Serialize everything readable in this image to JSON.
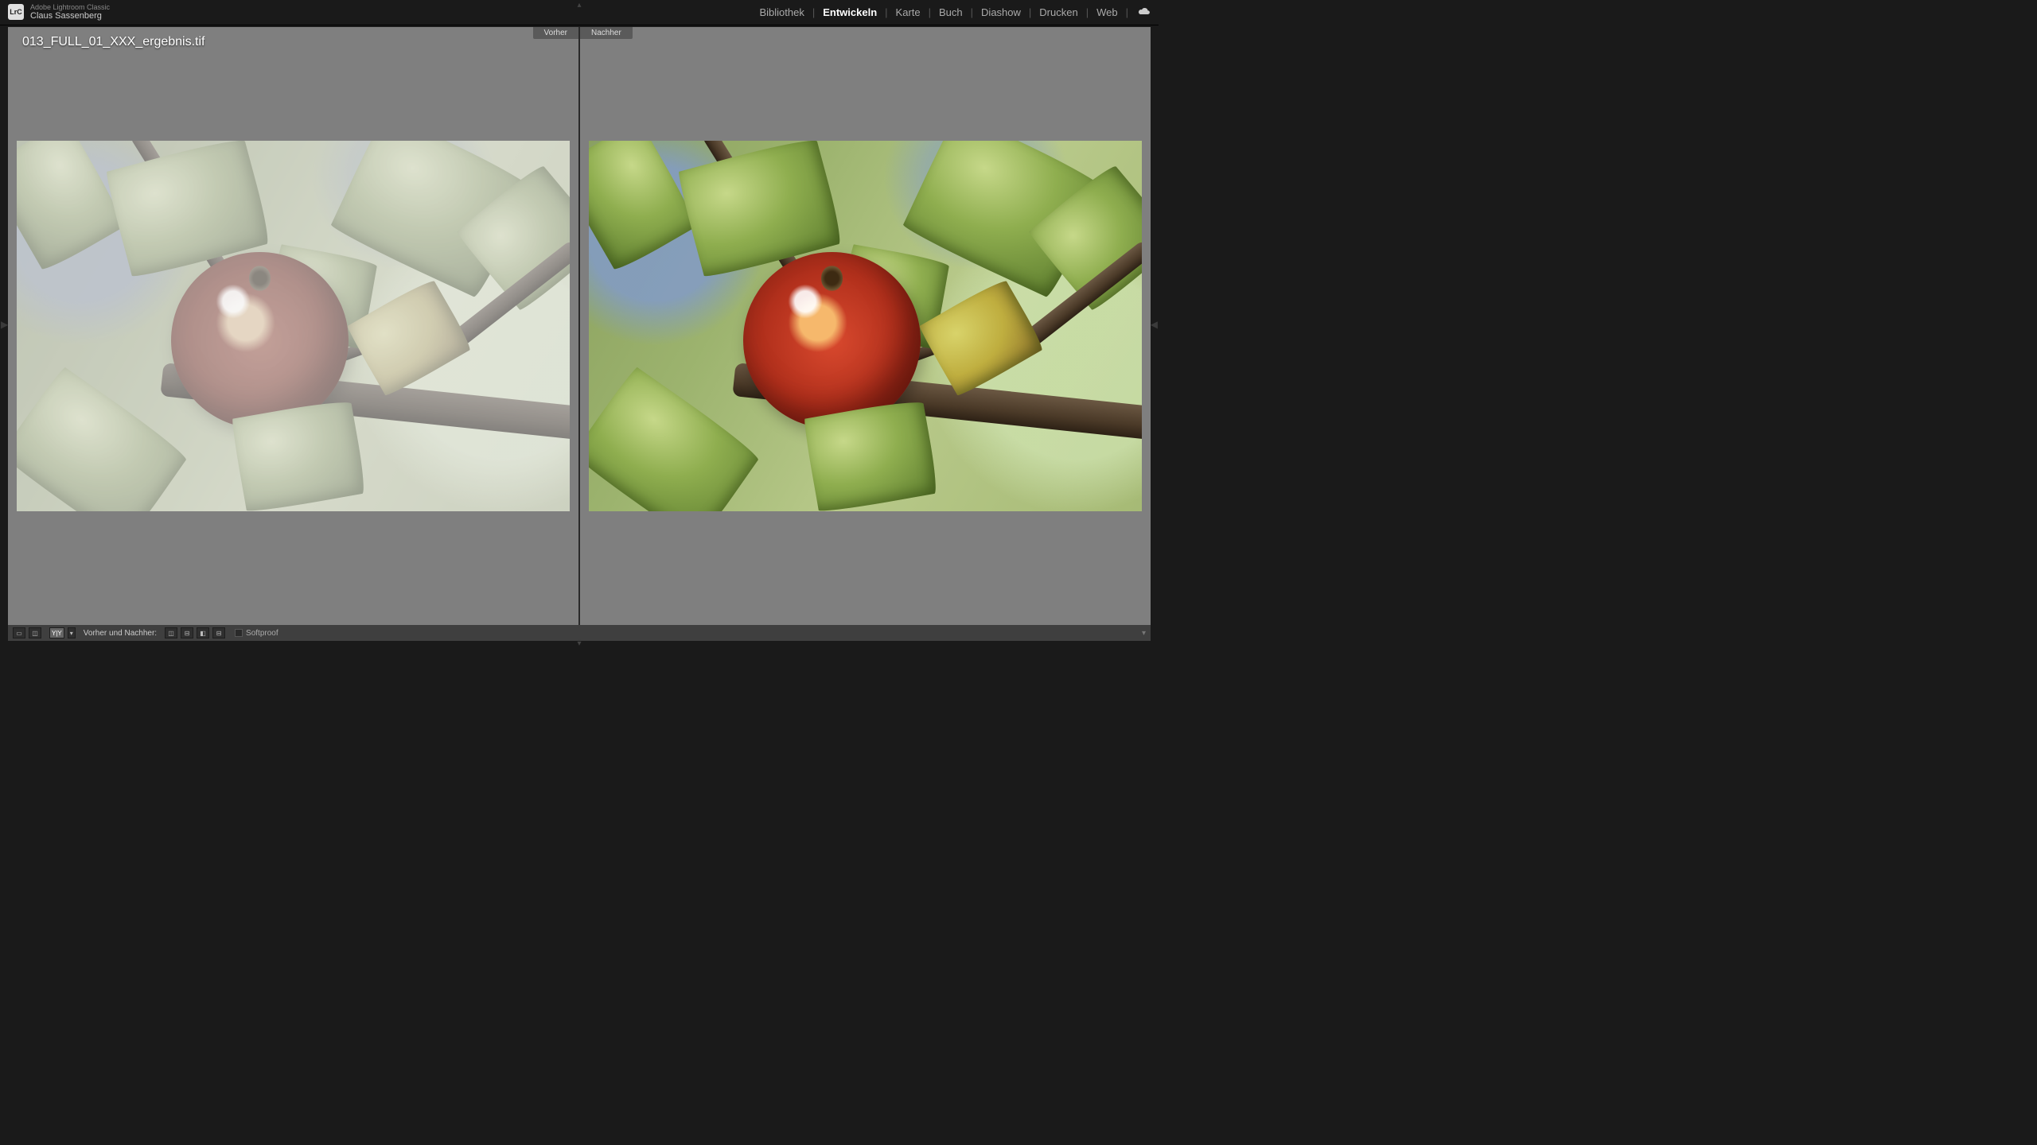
{
  "app": {
    "logo_text": "LrC",
    "title": "Adobe Lightroom Classic",
    "user": "Claus Sassenberg"
  },
  "modules": {
    "items": [
      {
        "label": "Bibliothek",
        "active": false
      },
      {
        "label": "Entwickeln",
        "active": true
      },
      {
        "label": "Karte",
        "active": false
      },
      {
        "label": "Buch",
        "active": false
      },
      {
        "label": "Diashow",
        "active": false
      },
      {
        "label": "Drucken",
        "active": false
      },
      {
        "label": "Web",
        "active": false
      }
    ]
  },
  "compare": {
    "filename": "013_FULL_01_XXX_ergebnis.tif",
    "before_label": "Vorher",
    "after_label": "Nachher"
  },
  "toolbar": {
    "loupe_icon": "▭",
    "compare_icon_1": "◫",
    "compare_icon_2": "Y|Y",
    "dropdown_icon": "▾",
    "label": "Vorher und Nachher:",
    "mode_lr": "◫",
    "mode_tb": "⊟",
    "mode_split_v": "◧",
    "mode_split_h": "⊟",
    "softproof_label": "Softproof"
  }
}
